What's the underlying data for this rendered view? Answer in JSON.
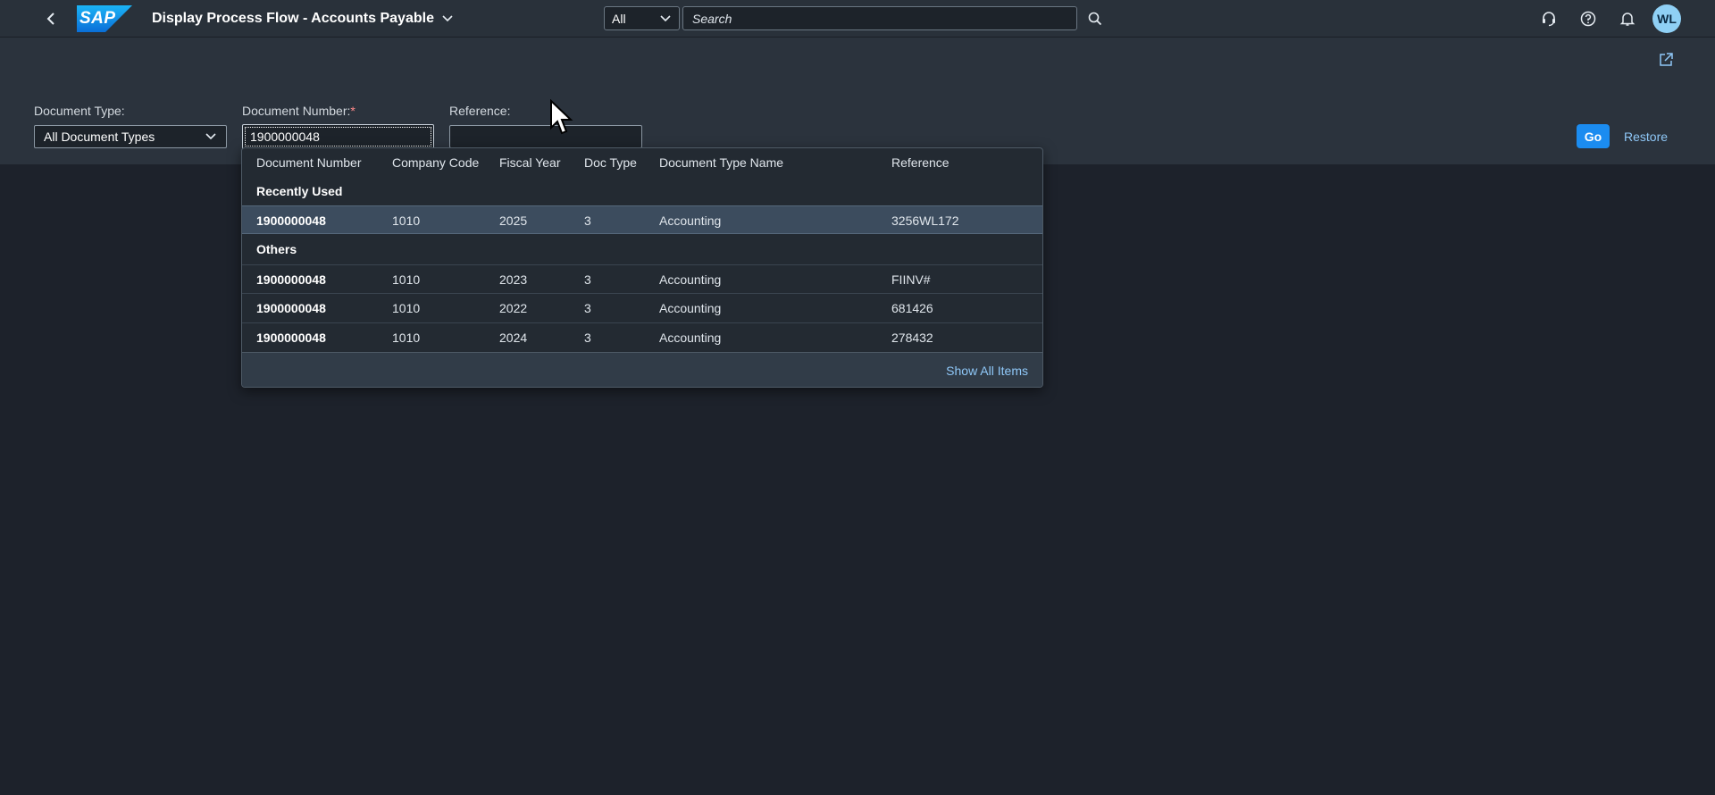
{
  "shell": {
    "title": "Display Process Flow - Accounts Payable",
    "logo_text": "SAP",
    "search_scope": "All",
    "search_placeholder": "Search",
    "user_initials": "WL",
    "colors": {
      "shell_bg": "#29313a",
      "accent": "#1b8cf0",
      "avatar": "#8fd0f5"
    }
  },
  "filters": {
    "document_type": {
      "label": "Document Type:",
      "value": "All Document Types"
    },
    "document_number": {
      "label": "Document Number:",
      "required_marker": "*",
      "value": "1900000048"
    },
    "reference": {
      "label": "Reference:",
      "value": ""
    },
    "go_label": "Go",
    "restore_label": "Restore"
  },
  "suggestions": {
    "columns": [
      "Document Number",
      "Company Code",
      "Fiscal Year",
      "Doc Type",
      "Document Type Name",
      "Reference"
    ],
    "recently_used_label": "Recently Used",
    "recently_used": [
      [
        "1900000048",
        "1010",
        "2025",
        "3",
        "Accounting",
        "3256WL172"
      ]
    ],
    "others_label": "Others",
    "others": [
      [
        "1900000048",
        "1010",
        "2023",
        "3",
        "Accounting",
        "FIINV#"
      ],
      [
        "1900000048",
        "1010",
        "2022",
        "3",
        "Accounting",
        "681426"
      ],
      [
        "1900000048",
        "1010",
        "2024",
        "3",
        "Accounting",
        "278432"
      ]
    ],
    "show_all_label": "Show All Items"
  }
}
